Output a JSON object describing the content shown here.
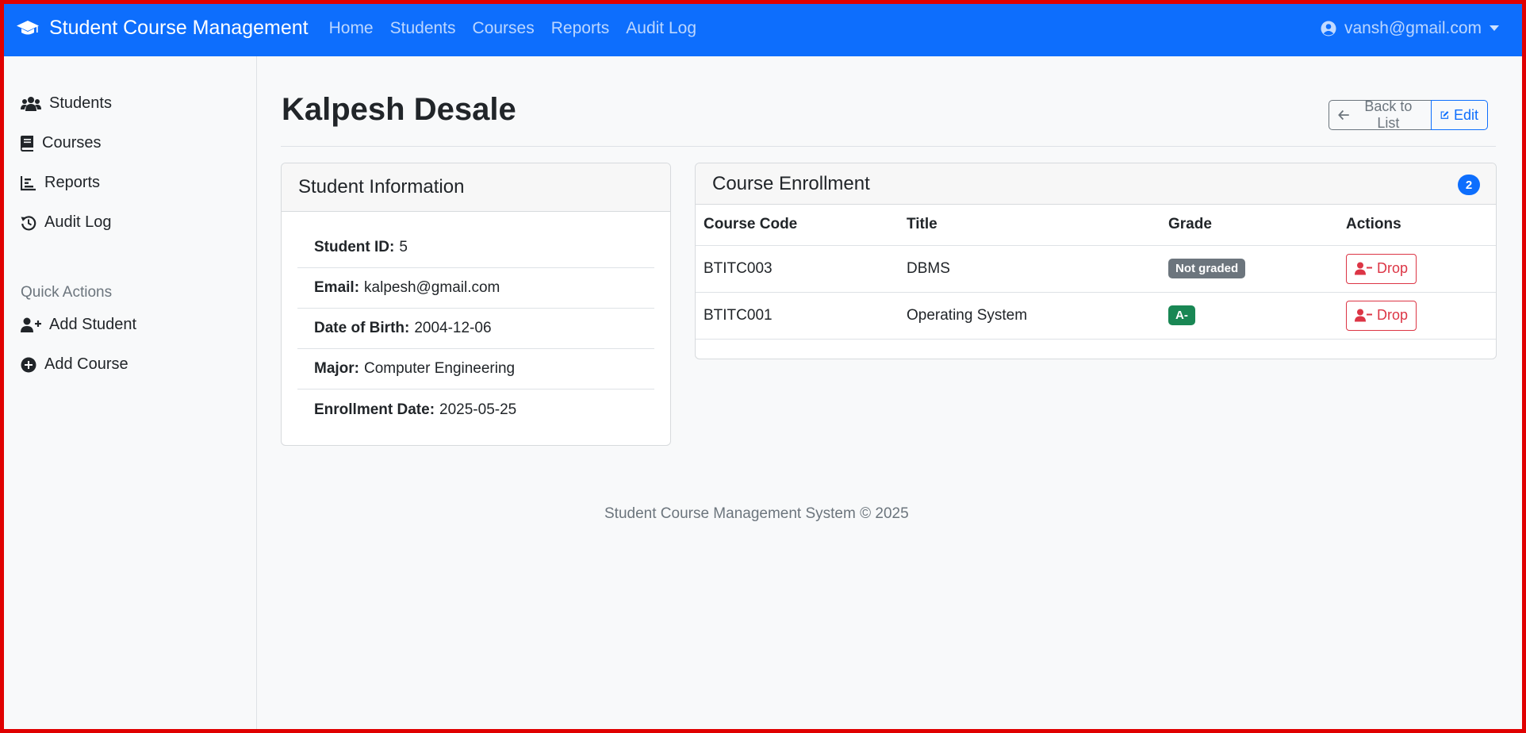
{
  "navbar": {
    "brand": "Student Course Management",
    "links": [
      "Home",
      "Students",
      "Courses",
      "Reports",
      "Audit Log"
    ],
    "user": "vansh@gmail.com",
    "bg_color": "#0d6efd"
  },
  "sidebar": {
    "items": [
      {
        "label": "Students",
        "icon": "users-icon"
      },
      {
        "label": "Courses",
        "icon": "book-icon"
      },
      {
        "label": "Reports",
        "icon": "chart-icon"
      },
      {
        "label": "Audit Log",
        "icon": "history-icon"
      }
    ],
    "quick_actions_heading": "Quick Actions",
    "quick_actions": [
      {
        "label": "Add Student",
        "icon": "user-plus-icon"
      },
      {
        "label": "Add Course",
        "icon": "plus-circle-icon"
      }
    ]
  },
  "page": {
    "title": "Kalpesh Desale",
    "back_label": "Back to List",
    "edit_label": "Edit"
  },
  "student_info": {
    "header": "Student Information",
    "fields": [
      {
        "label": "Student ID:",
        "value": "5"
      },
      {
        "label": "Email:",
        "value": "kalpesh@gmail.com"
      },
      {
        "label": "Date of Birth:",
        "value": "2004-12-06"
      },
      {
        "label": "Major:",
        "value": "Computer Engineering"
      },
      {
        "label": "Enrollment Date:",
        "value": "2025-05-25"
      }
    ]
  },
  "enrollment": {
    "header": "Course Enrollment",
    "count": "2",
    "columns": [
      "Course Code",
      "Title",
      "Grade",
      "Actions"
    ],
    "rows": [
      {
        "code": "BTITC003",
        "title": "DBMS",
        "grade": "Not graded",
        "grade_color": "#6c757d",
        "action": "Drop"
      },
      {
        "code": "BTITC001",
        "title": "Operating System",
        "grade": "A-",
        "grade_color": "#198754",
        "action": "Drop"
      }
    ]
  },
  "footer": "Student Course Management System © 2025"
}
